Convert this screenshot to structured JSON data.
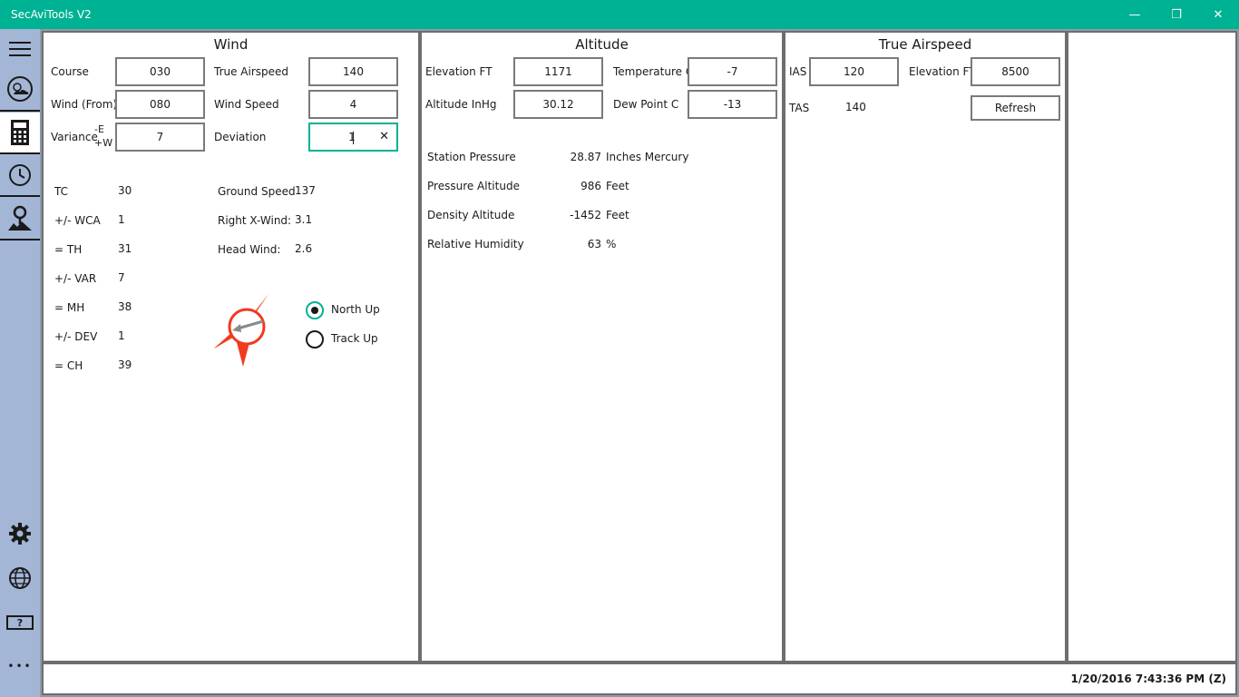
{
  "app": {
    "title": "SecAviTools V2"
  },
  "window_controls": {
    "minimize": "—",
    "restore": "❐",
    "close": "✕"
  },
  "sidebar": {
    "items": [
      {
        "name": "menu",
        "icon": "hamburger-icon"
      },
      {
        "name": "weather",
        "icon": "weather-icon"
      },
      {
        "name": "calculator",
        "icon": "calculator-icon",
        "active": true
      },
      {
        "name": "clock",
        "icon": "clock-icon"
      },
      {
        "name": "map",
        "icon": "map-pin-icon"
      },
      {
        "name": "settings",
        "icon": "gear-icon"
      },
      {
        "name": "globe",
        "icon": "globe-icon"
      },
      {
        "name": "help",
        "icon": "help-icon",
        "label": "?"
      },
      {
        "name": "more",
        "icon": "more-icon",
        "label": "•••"
      }
    ]
  },
  "wind": {
    "title": "Wind",
    "course_label": "Course",
    "course": "030",
    "true_airspeed_label": "True Airspeed",
    "true_airspeed": "140",
    "wind_from_label": "Wind (From)",
    "wind_from": "080",
    "wind_speed_label": "Wind Speed",
    "wind_speed": "4",
    "variance_label": "Variance",
    "variance_e": "-E",
    "variance_w": "+W",
    "variance": "7",
    "deviation_label": "Deviation",
    "deviation": "1",
    "results": [
      {
        "label": "TC",
        "value": "30"
      },
      {
        "label": "+/- WCA",
        "value": "1"
      },
      {
        "label": "= TH",
        "value": "31"
      },
      {
        "label": "+/- VAR",
        "value": "7"
      },
      {
        "label": "= MH",
        "value": "38"
      },
      {
        "label": "+/- DEV",
        "value": "1"
      },
      {
        "label": "= CH",
        "value": "39"
      }
    ],
    "ground_speed_label": "Ground Speed",
    "ground_speed": "137",
    "xwind_label": "Right X-Wind:",
    "xwind": "3.1",
    "headwind_label": "Head Wind:",
    "headwind": "2.6",
    "north_up_label": "North Up",
    "track_up_label": "Track Up",
    "orientation_selected": "North Up",
    "compass_color": "#f23a1f"
  },
  "altitude": {
    "title": "Altitude",
    "elevation_label": "Elevation FT",
    "elevation": "1171",
    "temperature_label": "Temperature C",
    "temperature": "-7",
    "altimeter_label": "Altitude InHg",
    "altimeter": "30.12",
    "dewpoint_label": "Dew Point C",
    "dewpoint": "-13",
    "results": [
      {
        "label": "Station Pressure",
        "value": "28.87",
        "unit": "Inches Mercury"
      },
      {
        "label": "Pressure Altitude",
        "value": "986",
        "unit": "Feet"
      },
      {
        "label": "Density Altitude",
        "value": "-1452",
        "unit": "Feet"
      },
      {
        "label": "Relative Humidity",
        "value": "63",
        "unit": "%"
      }
    ]
  },
  "tas": {
    "title": "True Airspeed",
    "ias_label": "IAS",
    "ias": "120",
    "elevation_label": "Elevation FT",
    "elevation": "8500",
    "tas_label": "TAS",
    "tas": "140",
    "refresh_label": "Refresh"
  },
  "status": {
    "datetime": "1/20/2016 7:43:36 PM (Z)"
  },
  "colors": {
    "accent": "#00b294",
    "sidebar": "#a3b6d6",
    "border": "#6e6e6e"
  }
}
